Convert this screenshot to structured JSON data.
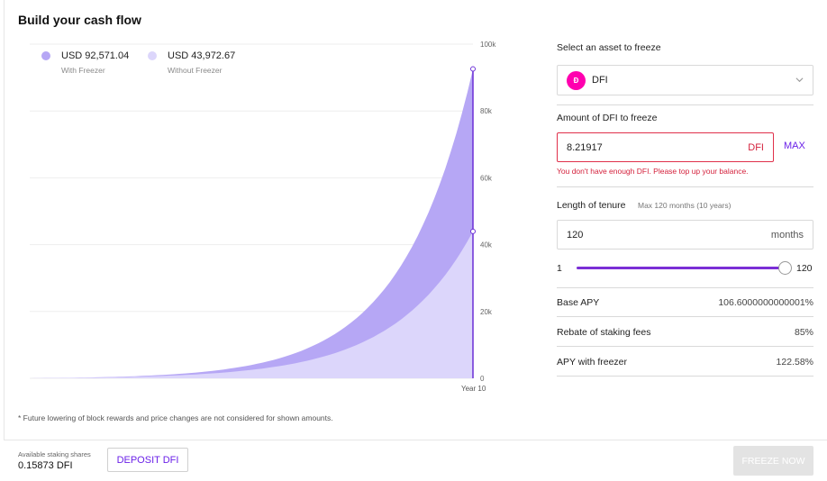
{
  "page": {
    "title": "Build your cash flow"
  },
  "legend": [
    {
      "value": "USD 92,571.04",
      "sub": "With Freezer",
      "color": "#b6a7f5"
    },
    {
      "value": "USD 43,972.67",
      "sub": "Without Freezer",
      "color": "#dcd6fb"
    }
  ],
  "chart_data": {
    "type": "area",
    "x_end_label": "Year 10",
    "y_ticks": [
      "100k",
      "80k",
      "60k",
      "40k",
      "20k",
      "0"
    ],
    "ylim": [
      0,
      100000
    ],
    "grid": true,
    "legend_position": "top-left",
    "series": [
      {
        "name": "With Freezer",
        "final_value": 92571.04,
        "color": "#b6a7f5"
      },
      {
        "name": "Without Freezer",
        "final_value": 43972.67,
        "color": "#dcd6fb"
      }
    ]
  },
  "footnote": "* Future lowering of block rewards and price changes are not considered for shown amounts.",
  "form": {
    "asset_label": "Select an asset to freeze",
    "asset_selected": "DFI",
    "asset_logo_text": "Đ",
    "amount_label": "Amount of DFI to freeze",
    "amount_value": "8.21917",
    "amount_unit": "DFI",
    "max_label": "MAX",
    "error_text": "You don't have enough DFI. Please top up your balance.",
    "tenure_label": "Length of tenure",
    "tenure_hint": "Max 120 months (10 years)",
    "tenure_value": "120",
    "tenure_unit": "months",
    "slider_min": "1",
    "slider_max": "120",
    "slider_fraction": 1.0
  },
  "stats": [
    {
      "label": "Base APY",
      "value": "106.6000000000001%"
    },
    {
      "label": "Rebate of staking fees",
      "value": "85%"
    },
    {
      "label": "APY with freezer",
      "value": "122.58%"
    }
  ],
  "bottom": {
    "avail_label": "Available staking shares",
    "avail_value": "0.15873 DFI",
    "deposit_label": "DEPOSIT DFI",
    "freeze_label": "FREEZE NOW"
  },
  "colors": {
    "accent": "#6b21e8",
    "error": "#d4213c",
    "dfi_pink": "#ff00af"
  }
}
